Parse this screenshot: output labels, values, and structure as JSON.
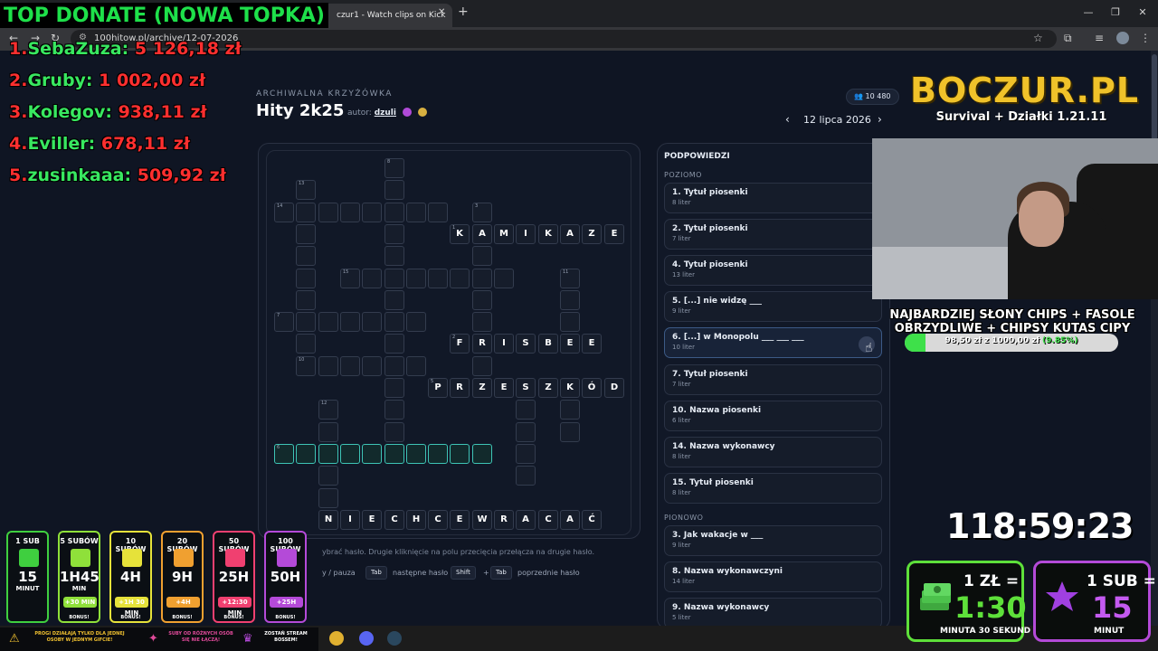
{
  "browser": {
    "tab_title": "czur1 - Watch clips on Kick",
    "tab_close": "✕",
    "new_tab": "+",
    "url": "100hitow.pl/archive/12-07-2026"
  },
  "puzzle": {
    "archive_label": "ARCHIWALNA KRZYŻÓWKA",
    "title": "Hity 2k25",
    "author_label": "autor:",
    "author_name": "dzuli",
    "players": "10 480",
    "date": "12 lipca 2026",
    "prev": "‹",
    "next": "›"
  },
  "grid": {
    "cells": [
      {
        "c": 5,
        "r": 0,
        "n": "8"
      },
      {
        "c": 1,
        "r": 1,
        "n": "13"
      },
      {
        "c": 5,
        "r": 1
      },
      {
        "c": 0,
        "r": 2,
        "n": "14"
      },
      {
        "c": 1,
        "r": 2
      },
      {
        "c": 2,
        "r": 2
      },
      {
        "c": 3,
        "r": 2
      },
      {
        "c": 4,
        "r": 2
      },
      {
        "c": 5,
        "r": 2
      },
      {
        "c": 6,
        "r": 2
      },
      {
        "c": 7,
        "r": 2
      },
      {
        "c": 9,
        "r": 2,
        "n": "3"
      },
      {
        "c": 1,
        "r": 3
      },
      {
        "c": 5,
        "r": 3
      },
      {
        "c": 8,
        "r": 3,
        "n": "1",
        "t": "K"
      },
      {
        "c": 9,
        "r": 3,
        "t": "A"
      },
      {
        "c": 10,
        "r": 3,
        "t": "M"
      },
      {
        "c": 11,
        "r": 3,
        "t": "I"
      },
      {
        "c": 12,
        "r": 3,
        "t": "K"
      },
      {
        "c": 13,
        "r": 3,
        "t": "A"
      },
      {
        "c": 14,
        "r": 3,
        "t": "Z"
      },
      {
        "c": 15,
        "r": 3,
        "t": "E"
      },
      {
        "c": 1,
        "r": 4
      },
      {
        "c": 5,
        "r": 4
      },
      {
        "c": 9,
        "r": 4
      },
      {
        "c": 1,
        "r": 5
      },
      {
        "c": 3,
        "r": 5,
        "n": "15"
      },
      {
        "c": 4,
        "r": 5
      },
      {
        "c": 5,
        "r": 5
      },
      {
        "c": 6,
        "r": 5
      },
      {
        "c": 7,
        "r": 5
      },
      {
        "c": 8,
        "r": 5
      },
      {
        "c": 9,
        "r": 5
      },
      {
        "c": 10,
        "r": 5
      },
      {
        "c": 13,
        "r": 5,
        "n": "11"
      },
      {
        "c": 1,
        "r": 6
      },
      {
        "c": 5,
        "r": 6
      },
      {
        "c": 9,
        "r": 6
      },
      {
        "c": 13,
        "r": 6
      },
      {
        "c": 0,
        "r": 7,
        "n": "7"
      },
      {
        "c": 1,
        "r": 7
      },
      {
        "c": 2,
        "r": 7
      },
      {
        "c": 3,
        "r": 7
      },
      {
        "c": 4,
        "r": 7
      },
      {
        "c": 5,
        "r": 7
      },
      {
        "c": 6,
        "r": 7
      },
      {
        "c": 9,
        "r": 7
      },
      {
        "c": 13,
        "r": 7
      },
      {
        "c": 1,
        "r": 8
      },
      {
        "c": 5,
        "r": 8
      },
      {
        "c": 8,
        "r": 8,
        "n": "2",
        "t": "F"
      },
      {
        "c": 9,
        "r": 8,
        "t": "R"
      },
      {
        "c": 10,
        "r": 8,
        "t": "I"
      },
      {
        "c": 11,
        "r": 8,
        "t": "S"
      },
      {
        "c": 12,
        "r": 8,
        "t": "B"
      },
      {
        "c": 13,
        "r": 8,
        "t": "E"
      },
      {
        "c": 14,
        "r": 8,
        "t": "E"
      },
      {
        "c": 1,
        "r": 9,
        "n": "10"
      },
      {
        "c": 2,
        "r": 9
      },
      {
        "c": 3,
        "r": 9
      },
      {
        "c": 4,
        "r": 9
      },
      {
        "c": 5,
        "r": 9
      },
      {
        "c": 6,
        "r": 9
      },
      {
        "c": 9,
        "r": 9
      },
      {
        "c": 5,
        "r": 10
      },
      {
        "c": 7,
        "r": 10,
        "n": "5",
        "t": "P"
      },
      {
        "c": 8,
        "r": 10,
        "t": "R"
      },
      {
        "c": 9,
        "r": 10,
        "t": "Z"
      },
      {
        "c": 10,
        "r": 10,
        "t": "E"
      },
      {
        "c": 11,
        "r": 10,
        "t": "S"
      },
      {
        "c": 12,
        "r": 10,
        "t": "Z"
      },
      {
        "c": 13,
        "r": 10,
        "t": "K"
      },
      {
        "c": 14,
        "r": 10,
        "t": "Ó"
      },
      {
        "c": 15,
        "r": 10,
        "t": "D"
      },
      {
        "c": 2,
        "r": 11,
        "n": "12"
      },
      {
        "c": 5,
        "r": 11
      },
      {
        "c": 11,
        "r": 11
      },
      {
        "c": 13,
        "r": 11
      },
      {
        "c": 2,
        "r": 12
      },
      {
        "c": 5,
        "r": 12
      },
      {
        "c": 11,
        "r": 12
      },
      {
        "c": 13,
        "r": 12
      },
      {
        "c": 0,
        "r": 13,
        "n": "6",
        "a": 1
      },
      {
        "c": 1,
        "r": 13,
        "a": 1
      },
      {
        "c": 2,
        "r": 13,
        "a": 1
      },
      {
        "c": 3,
        "r": 13,
        "a": 1
      },
      {
        "c": 4,
        "r": 13,
        "a": 1
      },
      {
        "c": 5,
        "r": 13,
        "a": 1
      },
      {
        "c": 6,
        "r": 13,
        "a": 1
      },
      {
        "c": 7,
        "r": 13,
        "a": 1
      },
      {
        "c": 8,
        "r": 13,
        "a": 1
      },
      {
        "c": 9,
        "r": 13,
        "a": 1
      },
      {
        "c": 11,
        "r": 13
      },
      {
        "c": 2,
        "r": 14
      },
      {
        "c": 11,
        "r": 14
      },
      {
        "c": 2,
        "r": 15
      },
      {
        "c": 2,
        "r": 16,
        "t": "N"
      },
      {
        "c": 3,
        "r": 16,
        "t": "I"
      },
      {
        "c": 4,
        "r": 16,
        "t": "E"
      },
      {
        "c": 5,
        "r": 16,
        "t": "C"
      },
      {
        "c": 6,
        "r": 16,
        "t": "H"
      },
      {
        "c": 7,
        "r": 16,
        "t": "C"
      },
      {
        "c": 8,
        "r": 16,
        "t": "E"
      },
      {
        "c": 9,
        "r": 16,
        "t": "W"
      },
      {
        "c": 10,
        "r": 16,
        "t": "R"
      },
      {
        "c": 11,
        "r": 16,
        "t": "A"
      },
      {
        "c": 12,
        "r": 16,
        "t": "C"
      },
      {
        "c": 13,
        "r": 16,
        "t": "A"
      },
      {
        "c": 14,
        "r": 16,
        "t": "Ć"
      }
    ],
    "hint": "ybrać hasło. Drugie kliknięcie na polu przecięcia przełącza na drugie hasło.",
    "keys": {
      "space_text": "y / pauza",
      "tab": "Tab",
      "tab_text": "następne hasło",
      "shift": "Shift",
      "plus": "+",
      "shift_tab_text": "poprzednie hasło"
    }
  },
  "clues": {
    "title": "PODPOWIEDZI",
    "across_label": "POZIOMO",
    "down_label": "PIONOWO",
    "across": [
      {
        "main": "1. Tytuł piosenki",
        "sub": "8 liter"
      },
      {
        "main": "2. Tytuł piosenki",
        "sub": "7 liter"
      },
      {
        "main": "4. Tytuł piosenki",
        "sub": "13 liter"
      },
      {
        "main": "5. [...] nie widzę ___",
        "sub": "9 liter"
      },
      {
        "main": "6. [...] w Monopolu ___ ___ ___",
        "sub": "10 liter"
      },
      {
        "main": "7. Tytuł piosenki",
        "sub": "7 liter"
      },
      {
        "main": "10. Nazwa piosenki",
        "sub": "6 liter"
      },
      {
        "main": "14. Nazwa wykonawcy",
        "sub": "8 liter"
      },
      {
        "main": "15. Tytuł piosenki",
        "sub": "8 liter"
      }
    ],
    "down": [
      {
        "main": "3. Jak wakacje w ___",
        "sub": "9 liter"
      },
      {
        "main": "8. Nazwa wykonawczyni",
        "sub": "14 liter"
      },
      {
        "main": "9. Nazwa wykonawcy",
        "sub": "5 liter"
      }
    ],
    "active_index": 4
  },
  "overlay": {
    "top_donate": "TOP DONATE (NOWA TOPKA)",
    "donors": [
      {
        "rank": "1.",
        "name": "SebaZuza:",
        "amount": "5 126,18 zł"
      },
      {
        "rank": "2.",
        "name": "Gruby:",
        "amount": "1 002,00 zł"
      },
      {
        "rank": "3.",
        "name": "Kolegov:",
        "amount": "938,11 zł"
      },
      {
        "rank": "4.",
        "name": "Eviller:",
        "amount": "678,11 zł"
      },
      {
        "rank": "5.",
        "name": "zusinkaaa:",
        "amount": "509,92 zł"
      }
    ],
    "logo_main": "BOCZUR.PL",
    "logo_sub": "Survival + Działki 1.21.11",
    "goal_title_1": "NAJBARDZIEJ SŁONY CHIPS + FASOLE",
    "goal_title_2": "OBRZYDLIWE + CHIPSY KUTAS CIPY",
    "goal_amount": "98,50 zł z 1000,00 zł",
    "goal_pct": "(9.85%)",
    "goal_fraction": 0.0985,
    "timer": "118:59:23",
    "sub_tiers": [
      {
        "label": "1 SUB",
        "time": "15",
        "unit": "MINUT",
        "bonus": "",
        "color": "#3fcf3f"
      },
      {
        "label": "5 SUBÓW",
        "time": "1H45",
        "unit": "MIN",
        "bonus": "+30 MIN",
        "color": "#8fe03a"
      },
      {
        "label": "10 SUBÓW",
        "time": "4H",
        "unit": "",
        "bonus": "+1H 30 MIN",
        "color": "#e6e23a"
      },
      {
        "label": "20 SUBÓW",
        "time": "9H",
        "unit": "",
        "bonus": "+4H",
        "color": "#f0a030"
      },
      {
        "label": "50 SUBÓW",
        "time": "25H",
        "unit": "",
        "bonus": "+12:30 MIN",
        "color": "#f04070"
      },
      {
        "label": "100 SUBÓW",
        "time": "50H",
        "unit": "",
        "bonus": "+25H",
        "color": "#b44ad8"
      }
    ],
    "bonus_label": "BONUS!",
    "info_1": "PROGI DZIAŁAJĄ TYLKO DLA JEDNEJ OSOBY W JEDNYM GIFCIE!",
    "info_2": "SUBY OD RÓŻNYCH OSÓB SIĘ NIE ŁĄCZĄ!",
    "info_3": "ZOSTAŃ STREAM BOSSEM!",
    "rate_money_top": "1 ZŁ =",
    "rate_money_big": "1:30",
    "rate_money_unit": "MINUTA 30 SEKUND",
    "rate_sub_top": "1 SUB =",
    "rate_sub_big": "15",
    "rate_sub_unit": "MINUT"
  },
  "colors": {
    "accent_green": "#3ee04a",
    "active_cell": "#3ec4b6",
    "donate_red": "#ff2f2f",
    "logo_gold": "#f0c22a",
    "sub_purple": "#b44ad8"
  }
}
